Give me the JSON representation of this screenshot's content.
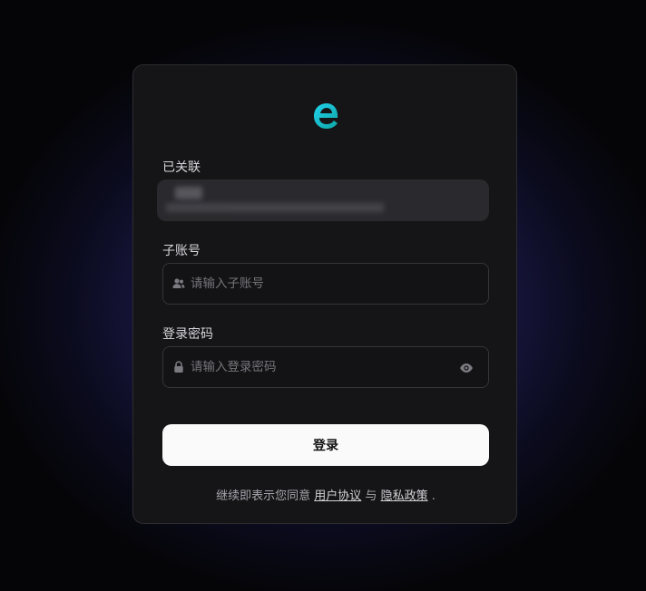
{
  "linked": {
    "label": "已关联",
    "value": ""
  },
  "sub_account": {
    "label": "子账号",
    "placeholder": "请输入子账号",
    "icon": "users-icon"
  },
  "password": {
    "label": "登录密码",
    "placeholder": "请输入登录密码",
    "icon": "lock-icon",
    "toggle_icon": "eye-icon"
  },
  "login_button": "登录",
  "terms": {
    "prefix": "继续即表示您同意",
    "user_agreement": "用户协议",
    "and": "与",
    "privacy_policy": "隐私政策",
    "suffix": "."
  },
  "colors": {
    "accent_start": "#22d3ee",
    "accent_end": "#14b8a6",
    "card_bg": "#151517",
    "button_bg": "#fafafa"
  }
}
